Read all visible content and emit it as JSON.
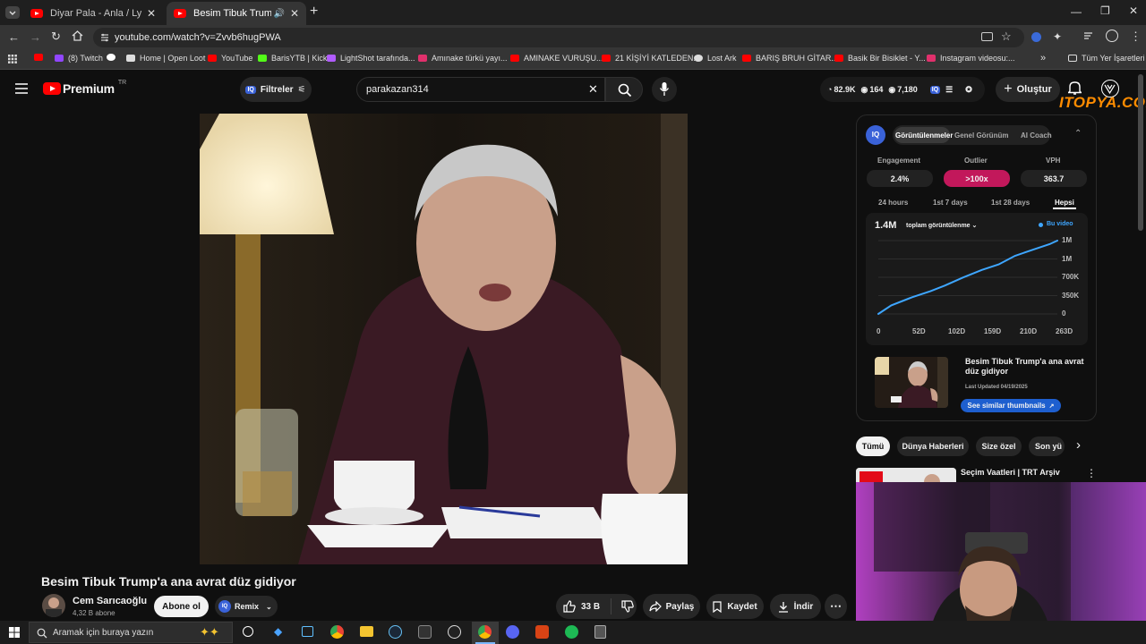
{
  "browser": {
    "tabs": [
      {
        "title": "Diyar Pala - Anla / Lyrics - Sözle",
        "active": false
      },
      {
        "title": "Besim Tibuk Trump'a ana av",
        "active": true
      }
    ],
    "url": "youtube.com/watch?v=Zvvb6hugPWA",
    "bookmarks": [
      {
        "label": "",
        "color": "#ff0000"
      },
      {
        "label": "(8) Twitch",
        "color": "#9146ff"
      },
      {
        "label": "",
        "color": "#ffffff"
      },
      {
        "label": "Home | Open Loot",
        "color": "#dddddd"
      },
      {
        "label": "YouTube",
        "color": "#ff0000"
      },
      {
        "label": "BarisYTB | Kick",
        "color": "#53fc18"
      },
      {
        "label": "LightShot tarafında...",
        "color": "#b15cff"
      },
      {
        "label": "Amınake türkü yayı...",
        "color": "#e1306c"
      },
      {
        "label": "AMINAKE VURUŞU...",
        "color": "#ff0000"
      },
      {
        "label": "21 KİŞİYİ KATLEDEN...",
        "color": "#ff0000"
      },
      {
        "label": "Lost Ark",
        "color": "#dddddd"
      },
      {
        "label": "BARIŞ BRUH GİTAR...",
        "color": "#ff0000"
      },
      {
        "label": "Basik Bir Bisiklet - Y...",
        "color": "#ff0000"
      },
      {
        "label": "Instagram videosu:...",
        "color": "#e1306c"
      }
    ],
    "all_bookmarks": "Tüm Yer İşaretleri"
  },
  "header": {
    "logo": "Premium",
    "logo_sup": "TR",
    "filters": "Filtreler",
    "search_value": "parakazan314",
    "stats": [
      "82.9K",
      "164",
      "7,180"
    ],
    "create": "Oluştur",
    "watermark": "ITOPYA.COM"
  },
  "video": {
    "title": "Besim Tibuk Trump'a ana avrat düz gidiyor"
  },
  "channel": {
    "name": "Cem Sarıcaoğlu",
    "subs": "4,32 B abone",
    "subscribe": "Abone ol",
    "remix": "Remix"
  },
  "actions": {
    "likes": "33 B",
    "share": "Paylaş",
    "save": "Kaydet",
    "download": "İndir"
  },
  "panel": {
    "tabs": [
      "Görüntülenmeler",
      "Genel Görünüm",
      "AI Coach"
    ],
    "metrics": [
      {
        "label": "Engagement",
        "value": "2.4%"
      },
      {
        "label": "Outlier",
        "value": ">100x"
      },
      {
        "label": "VPH",
        "value": "363.7"
      }
    ],
    "ranges": [
      "24 hours",
      "1st 7 days",
      "1st 28 days",
      "Hepsi"
    ],
    "total": "1.4M",
    "metric_select": "toplam görüntülenme",
    "legend": "Bu video",
    "video_title": "Besim Tibuk Trump'a ana avrat düz gidiyor",
    "last_updated": "Last Updated 04/19/2025",
    "similar": "See similar thumbnails"
  },
  "chart_data": {
    "type": "line",
    "x_ticks": [
      "0",
      "52D",
      "102D",
      "159D",
      "210D",
      "263D"
    ],
    "y_ticks": [
      "1M",
      "1M",
      "700K",
      "350K",
      "0"
    ],
    "x": [
      0,
      20,
      52,
      80,
      102,
      130,
      159,
      185,
      210,
      240,
      263,
      275
    ],
    "values": [
      0,
      170000,
      330000,
      450000,
      560000,
      720000,
      870000,
      980000,
      1150000,
      1280000,
      1380000,
      1450000
    ],
    "series": [
      {
        "name": "Bu video",
        "color": "#3ea6ff"
      }
    ],
    "ylim": [
      0,
      1450000
    ],
    "xlim": [
      0,
      275
    ]
  },
  "chips": [
    "Tümü",
    "Dünya Haberleri",
    "Size özel",
    "Son yü"
  ],
  "recommendation": {
    "title": "Seçim Vaatleri | TRT Arşiv"
  },
  "taskbar": {
    "search_placeholder": "Aramak için buraya yazın"
  }
}
